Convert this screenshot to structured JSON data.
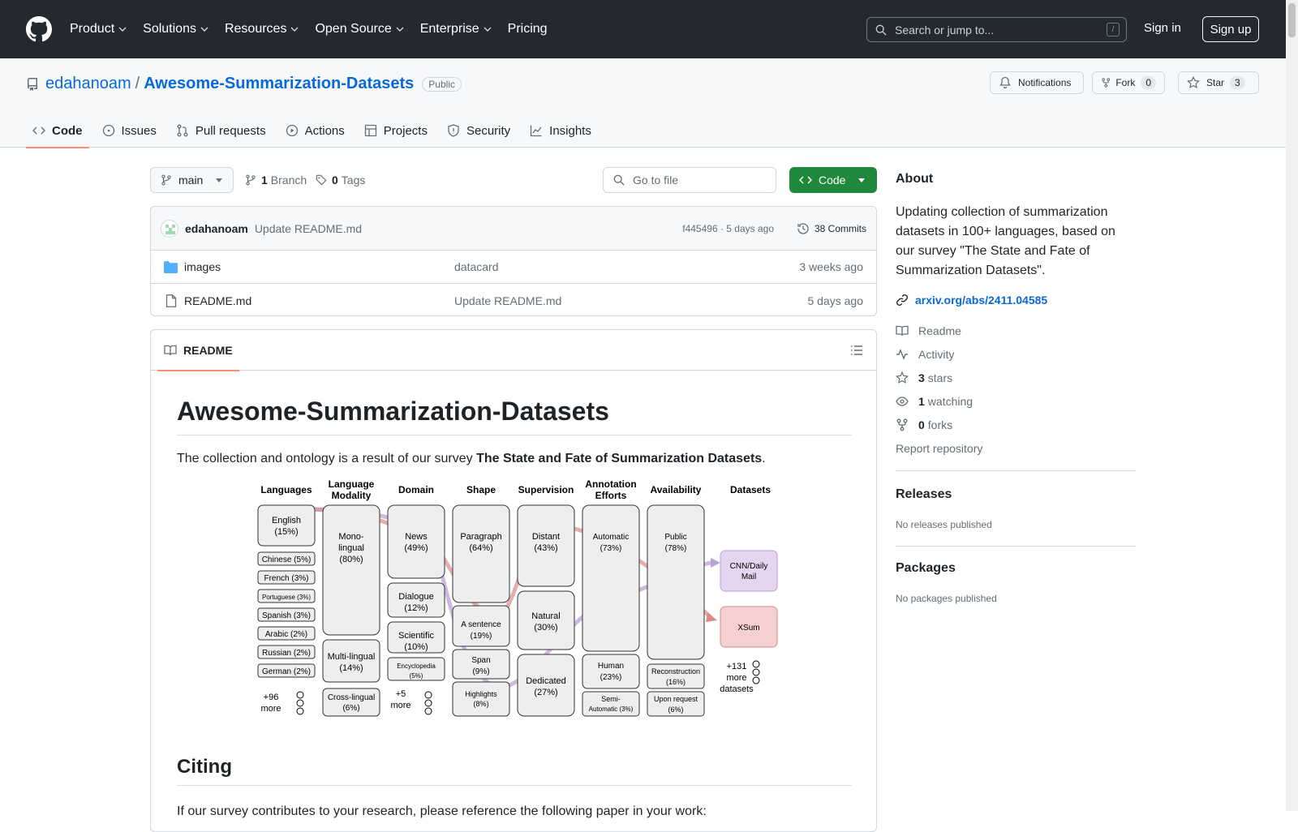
{
  "header": {
    "nav": [
      "Product",
      "Solutions",
      "Resources",
      "Open Source",
      "Enterprise",
      "Pricing"
    ],
    "search_placeholder": "Search or jump to...",
    "search_shortcut": "/",
    "signin": "Sign in",
    "signup": "Sign up"
  },
  "repo": {
    "owner": "edahanoam",
    "separator": "/",
    "name": "Awesome-Summarization-Datasets",
    "visibility": "Public",
    "notifications_label": "Notifications",
    "fork_label": "Fork",
    "fork_count": "0",
    "star_label": "Star",
    "star_count": "3",
    "tabs": [
      "Code",
      "Issues",
      "Pull requests",
      "Actions",
      "Projects",
      "Security",
      "Insights"
    ]
  },
  "toolbar": {
    "branch": "main",
    "branch_count": "1",
    "branch_label": "Branch",
    "tag_count": "0",
    "tag_label": "Tags",
    "goto_file": "Go to file",
    "code_button": "Code"
  },
  "commit": {
    "author": "edahanoam",
    "message": "Update README.md",
    "hash_time": "f445496 · 5 days ago",
    "commits_label": "38 Commits"
  },
  "files": [
    {
      "name": "images",
      "type": "folder",
      "message": "datacard",
      "time": "3 weeks ago"
    },
    {
      "name": "README.md",
      "type": "file",
      "message": "Update README.md",
      "time": "5 days ago"
    }
  ],
  "readme": {
    "tab_label": "README",
    "title": "Awesome-Summarization-Datasets",
    "intro_prefix": "The collection and ontology is a result of our survey ",
    "intro_bold": "The State and Fate of Summarization Datasets",
    "intro_suffix": ".",
    "citing_heading": "Citing",
    "citing_text": "If our survey contributes to your research, please reference the following paper in your work:"
  },
  "diagram": {
    "columns": [
      "Languages",
      "Language Modality",
      "Domain",
      "Shape",
      "Supervision",
      "Annotation Efforts",
      "Availability",
      "Datasets"
    ],
    "languages": [
      "English (15%)",
      "Chinese (5%)",
      "French (3%)",
      "Portuguese (3%)",
      "Spanish (3%)",
      "Arabic (2%)",
      "Russian (2%)",
      "German (2%)"
    ],
    "languages_more": "+96 more",
    "modality": [
      "Mono-lingual (80%)",
      "Multi-lingual (14%)",
      "Cross-lingual (6%)"
    ],
    "domain": [
      "News (49%)",
      "Dialogue (12%)",
      "Scientific (10%)",
      "Encyclopedia (5%)"
    ],
    "domain_more": "+5 more",
    "shape": [
      "Paragraph (64%)",
      "A sentence (19%)",
      "Span (9%)",
      "Highlights (8%)"
    ],
    "supervision": [
      "Distant (43%)",
      "Natural (30%)",
      "Dedicated (27%)"
    ],
    "annotation": [
      "Automatic (73%)",
      "Human (23%)",
      "Semi-Automatic (3%)"
    ],
    "availability": [
      "Public (78%)",
      "Reconstruction (16%)",
      "Upon request (6%)"
    ],
    "datasets": [
      "CNN/Daily Mail",
      "XSum"
    ],
    "datasets_more": "+131 more datasets",
    "colors": {
      "cnn": "#e6d5f0",
      "xsum": "#f6d0d0",
      "box": "#eeeeee",
      "purple_flow": "#b9a3d3",
      "red_flow": "#d98b8b"
    }
  },
  "sidebar": {
    "about_heading": "About",
    "description": "Updating collection of summarization datasets in 100+ languages, based on our survey \"The State and Fate of Summarization Datasets\".",
    "link": "arxiv.org/abs/2411.04585",
    "readme": "Readme",
    "activity": "Activity",
    "stars_count": "3",
    "stars_label": "stars",
    "watching_count": "1",
    "watching_label": "watching",
    "forks_count": "0",
    "forks_label": "forks",
    "report": "Report repository",
    "releases_heading": "Releases",
    "releases_text": "No releases published",
    "packages_heading": "Packages",
    "packages_text": "No packages published"
  }
}
